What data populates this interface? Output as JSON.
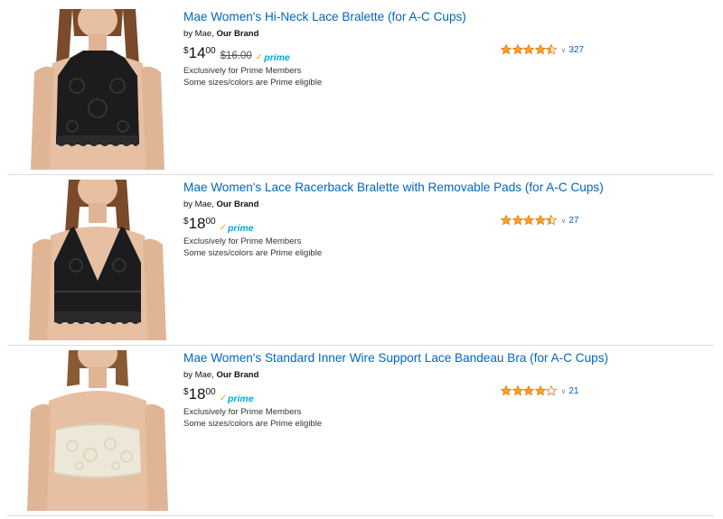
{
  "results": [
    {
      "title": "Mae Women's Hi-Neck Lace Bralette (for A-C Cups)",
      "by": "by Mae, ",
      "brand": "Our Brand",
      "price_symbol": "$",
      "price_whole": "14",
      "price_fraction": "00",
      "list_price": "$16.00",
      "prime_label": "prime",
      "exclusive_note": "Exclusively for Prime Members",
      "eligible_note": "Some sizes/colors are Prime eligible",
      "rating": 4.5,
      "review_count": "327",
      "product_color": "#1c1c1e",
      "image_icon": "hi-neck-bralette-image"
    },
    {
      "title": "Mae Women's Lace Racerback Bralette with Removable Pads (for A-C Cups)",
      "by": "by Mae, ",
      "brand": "Our Brand",
      "price_symbol": "$",
      "price_whole": "18",
      "price_fraction": "00",
      "list_price": "",
      "prime_label": "prime",
      "exclusive_note": "Exclusively for Prime Members",
      "eligible_note": "Some sizes/colors are Prime eligible",
      "rating": 4.5,
      "review_count": "27",
      "product_color": "#1c1c1e",
      "image_icon": "racerback-bralette-image"
    },
    {
      "title": "Mae Women's Standard Inner Wire Support Lace Bandeau Bra (for A-C Cups)",
      "by": "by Mae, ",
      "brand": "Our Brand",
      "price_symbol": "$",
      "price_whole": "18",
      "price_fraction": "00",
      "list_price": "",
      "prime_label": "prime",
      "exclusive_note": "Exclusively for Prime Members",
      "eligible_note": "Some sizes/colors are Prime eligible",
      "rating": 4.0,
      "review_count": "21",
      "product_color": "#ece7d7",
      "image_icon": "bandeau-bra-image"
    }
  ],
  "colors": {
    "link": "#0066c0",
    "star_fill": "#ffa41c",
    "star_stroke": "#de7921",
    "prime_blue": "#00a8e1",
    "prime_check": "#f7a21a",
    "skin": "#e7bfa2",
    "hair": "#7a4a2a"
  }
}
